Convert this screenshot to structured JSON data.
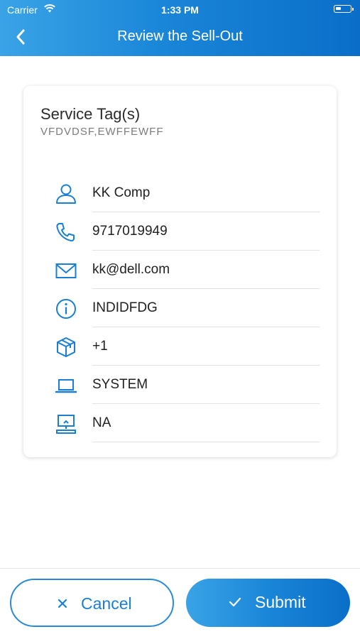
{
  "status_bar": {
    "carrier": "Carrier",
    "time": "1:33 PM"
  },
  "header": {
    "title": "Review the Sell-Out"
  },
  "card": {
    "tag_title": "Service Tag(s)",
    "tag_value": "VFDVDSF,EWFFEWFF",
    "rows": [
      {
        "icon": "user-icon",
        "value": "KK Comp"
      },
      {
        "icon": "phone-icon",
        "value": "9717019949"
      },
      {
        "icon": "mail-icon",
        "value": "kk@dell.com"
      },
      {
        "icon": "info-icon",
        "value": "INDIDFDG"
      },
      {
        "icon": "package-icon",
        "value": "+1"
      },
      {
        "icon": "laptop-icon",
        "value": "SYSTEM"
      },
      {
        "icon": "desktop-upload-icon",
        "value": "NA"
      }
    ]
  },
  "actions": {
    "cancel_label": "Cancel",
    "submit_label": "Submit"
  },
  "colors": {
    "accent": "#1a86d8",
    "accent_dark": "#0a6ec8",
    "accent_light": "#3aa3e6"
  }
}
